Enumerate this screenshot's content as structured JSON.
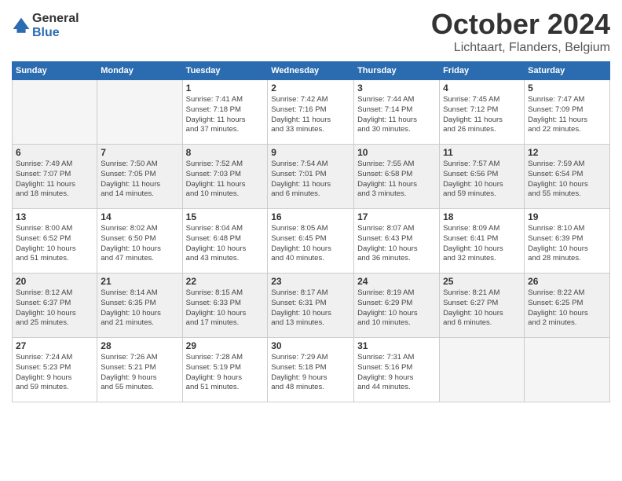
{
  "logo": {
    "line1": "General",
    "line2": "Blue"
  },
  "header": {
    "month": "October 2024",
    "location": "Lichtaart, Flanders, Belgium"
  },
  "days_of_week": [
    "Sunday",
    "Monday",
    "Tuesday",
    "Wednesday",
    "Thursday",
    "Friday",
    "Saturday"
  ],
  "weeks": [
    [
      {
        "day": "",
        "info": ""
      },
      {
        "day": "",
        "info": ""
      },
      {
        "day": "1",
        "info": "Sunrise: 7:41 AM\nSunset: 7:18 PM\nDaylight: 11 hours\nand 37 minutes."
      },
      {
        "day": "2",
        "info": "Sunrise: 7:42 AM\nSunset: 7:16 PM\nDaylight: 11 hours\nand 33 minutes."
      },
      {
        "day": "3",
        "info": "Sunrise: 7:44 AM\nSunset: 7:14 PM\nDaylight: 11 hours\nand 30 minutes."
      },
      {
        "day": "4",
        "info": "Sunrise: 7:45 AM\nSunset: 7:12 PM\nDaylight: 11 hours\nand 26 minutes."
      },
      {
        "day": "5",
        "info": "Sunrise: 7:47 AM\nSunset: 7:09 PM\nDaylight: 11 hours\nand 22 minutes."
      }
    ],
    [
      {
        "day": "6",
        "info": "Sunrise: 7:49 AM\nSunset: 7:07 PM\nDaylight: 11 hours\nand 18 minutes."
      },
      {
        "day": "7",
        "info": "Sunrise: 7:50 AM\nSunset: 7:05 PM\nDaylight: 11 hours\nand 14 minutes."
      },
      {
        "day": "8",
        "info": "Sunrise: 7:52 AM\nSunset: 7:03 PM\nDaylight: 11 hours\nand 10 minutes."
      },
      {
        "day": "9",
        "info": "Sunrise: 7:54 AM\nSunset: 7:01 PM\nDaylight: 11 hours\nand 6 minutes."
      },
      {
        "day": "10",
        "info": "Sunrise: 7:55 AM\nSunset: 6:58 PM\nDaylight: 11 hours\nand 3 minutes."
      },
      {
        "day": "11",
        "info": "Sunrise: 7:57 AM\nSunset: 6:56 PM\nDaylight: 10 hours\nand 59 minutes."
      },
      {
        "day": "12",
        "info": "Sunrise: 7:59 AM\nSunset: 6:54 PM\nDaylight: 10 hours\nand 55 minutes."
      }
    ],
    [
      {
        "day": "13",
        "info": "Sunrise: 8:00 AM\nSunset: 6:52 PM\nDaylight: 10 hours\nand 51 minutes."
      },
      {
        "day": "14",
        "info": "Sunrise: 8:02 AM\nSunset: 6:50 PM\nDaylight: 10 hours\nand 47 minutes."
      },
      {
        "day": "15",
        "info": "Sunrise: 8:04 AM\nSunset: 6:48 PM\nDaylight: 10 hours\nand 43 minutes."
      },
      {
        "day": "16",
        "info": "Sunrise: 8:05 AM\nSunset: 6:45 PM\nDaylight: 10 hours\nand 40 minutes."
      },
      {
        "day": "17",
        "info": "Sunrise: 8:07 AM\nSunset: 6:43 PM\nDaylight: 10 hours\nand 36 minutes."
      },
      {
        "day": "18",
        "info": "Sunrise: 8:09 AM\nSunset: 6:41 PM\nDaylight: 10 hours\nand 32 minutes."
      },
      {
        "day": "19",
        "info": "Sunrise: 8:10 AM\nSunset: 6:39 PM\nDaylight: 10 hours\nand 28 minutes."
      }
    ],
    [
      {
        "day": "20",
        "info": "Sunrise: 8:12 AM\nSunset: 6:37 PM\nDaylight: 10 hours\nand 25 minutes."
      },
      {
        "day": "21",
        "info": "Sunrise: 8:14 AM\nSunset: 6:35 PM\nDaylight: 10 hours\nand 21 minutes."
      },
      {
        "day": "22",
        "info": "Sunrise: 8:15 AM\nSunset: 6:33 PM\nDaylight: 10 hours\nand 17 minutes."
      },
      {
        "day": "23",
        "info": "Sunrise: 8:17 AM\nSunset: 6:31 PM\nDaylight: 10 hours\nand 13 minutes."
      },
      {
        "day": "24",
        "info": "Sunrise: 8:19 AM\nSunset: 6:29 PM\nDaylight: 10 hours\nand 10 minutes."
      },
      {
        "day": "25",
        "info": "Sunrise: 8:21 AM\nSunset: 6:27 PM\nDaylight: 10 hours\nand 6 minutes."
      },
      {
        "day": "26",
        "info": "Sunrise: 8:22 AM\nSunset: 6:25 PM\nDaylight: 10 hours\nand 2 minutes."
      }
    ],
    [
      {
        "day": "27",
        "info": "Sunrise: 7:24 AM\nSunset: 5:23 PM\nDaylight: 9 hours\nand 59 minutes."
      },
      {
        "day": "28",
        "info": "Sunrise: 7:26 AM\nSunset: 5:21 PM\nDaylight: 9 hours\nand 55 minutes."
      },
      {
        "day": "29",
        "info": "Sunrise: 7:28 AM\nSunset: 5:19 PM\nDaylight: 9 hours\nand 51 minutes."
      },
      {
        "day": "30",
        "info": "Sunrise: 7:29 AM\nSunset: 5:18 PM\nDaylight: 9 hours\nand 48 minutes."
      },
      {
        "day": "31",
        "info": "Sunrise: 7:31 AM\nSunset: 5:16 PM\nDaylight: 9 hours\nand 44 minutes."
      },
      {
        "day": "",
        "info": ""
      },
      {
        "day": "",
        "info": ""
      }
    ]
  ]
}
